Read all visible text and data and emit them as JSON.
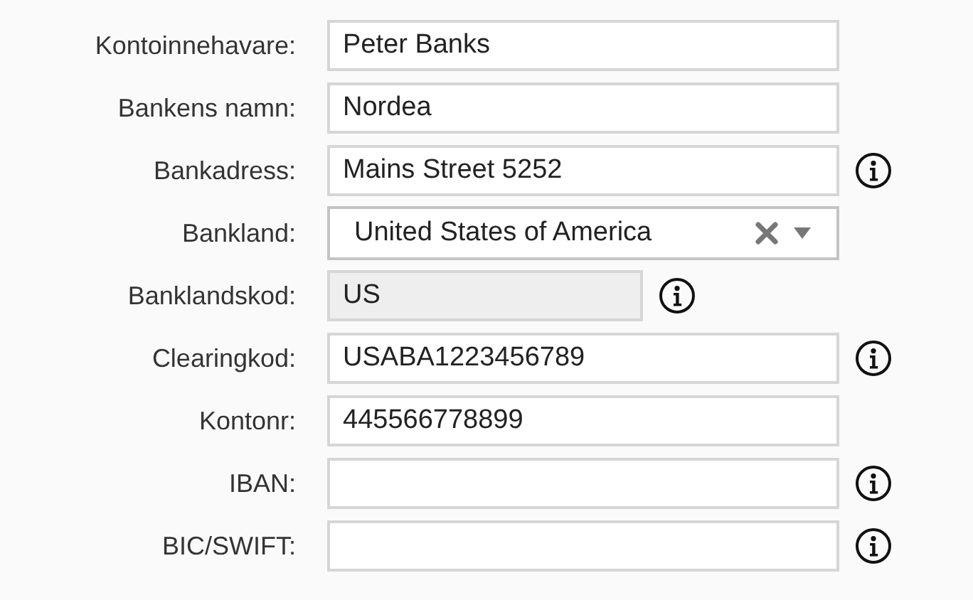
{
  "fields": [
    {
      "label": "Kontoinnehavare:",
      "kind": "text",
      "value": "Peter Banks",
      "info": false
    },
    {
      "label": "Bankens namn:",
      "kind": "text",
      "value": "Nordea",
      "info": false
    },
    {
      "label": "Bankadress:",
      "kind": "text",
      "value": "Mains Street 5252",
      "info": true
    },
    {
      "label": "Bankland:",
      "kind": "select",
      "value": "United States of America",
      "info": false
    },
    {
      "label": "Banklandskod:",
      "kind": "locked",
      "value": "US",
      "info": true
    },
    {
      "label": "Clearingkod:",
      "kind": "text",
      "value": "USABA1223456789",
      "info": true
    },
    {
      "label": "Kontonr:",
      "kind": "text",
      "value": "445566778899",
      "info": false
    },
    {
      "label": "IBAN:",
      "kind": "text",
      "info": true
    },
    {
      "label": "BIC/SWIFT:",
      "kind": "text",
      "info": true
    }
  ]
}
